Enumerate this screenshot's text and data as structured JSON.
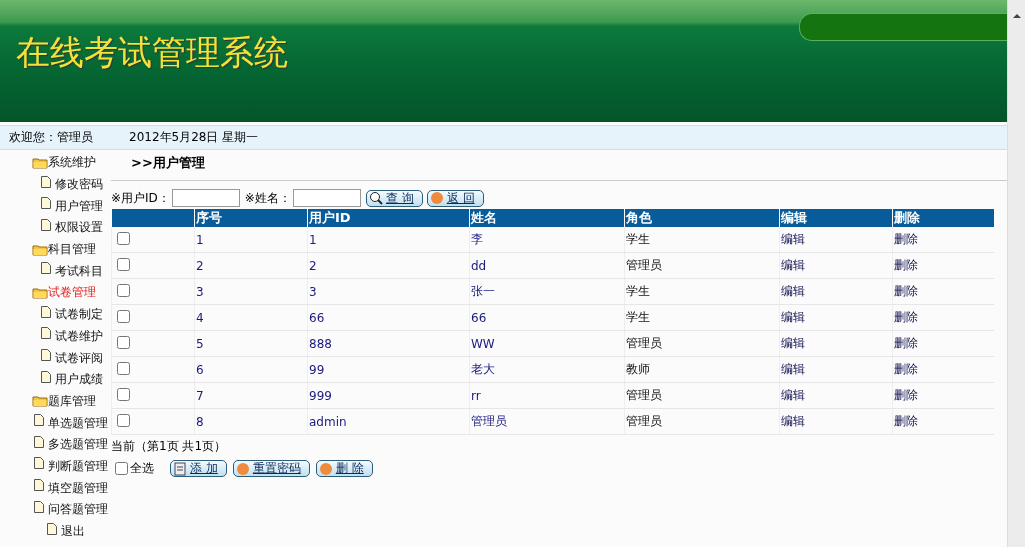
{
  "header": {
    "title": "在线考试管理系统"
  },
  "info_bar": {
    "welcome": "欢迎您：管理员",
    "date": "2012年5月28日  星期一"
  },
  "sidebar": {
    "items": [
      {
        "label": "系统维护",
        "selected": false,
        "children": [
          {
            "label": "修改密码",
            "selected": false
          },
          {
            "label": "用户管理",
            "selected": false
          },
          {
            "label": "权限设置",
            "selected": false
          }
        ]
      },
      {
        "label": "科目管理",
        "selected": false,
        "children": [
          {
            "label": "考试科目",
            "selected": false
          }
        ]
      },
      {
        "label": "试卷管理",
        "selected": true,
        "children": [
          {
            "label": "试卷制定",
            "selected": false
          },
          {
            "label": "试卷维护",
            "selected": false
          },
          {
            "label": "试卷评阅",
            "selected": false
          },
          {
            "label": "用户成绩",
            "selected": false
          }
        ]
      },
      {
        "label": "题库管理",
        "selected": false,
        "children": [
          {
            "label": "单选题管理",
            "selected": false
          },
          {
            "label": "多选题管理",
            "selected": false
          },
          {
            "label": "判断题管理",
            "selected": false
          },
          {
            "label": "填空题管理",
            "selected": false
          },
          {
            "label": "问答题管理",
            "selected": false,
            "children": [
              {
                "label": "退出",
                "selected": false
              }
            ]
          }
        ]
      }
    ]
  },
  "page_title": ">>用户管理",
  "search": {
    "fields": [
      {
        "label": "※用户ID："
      },
      {
        "label": "※姓名："
      }
    ],
    "buttons": [
      {
        "label": "查 询",
        "kind": "search"
      },
      {
        "label": "返 回",
        "kind": "back"
      }
    ]
  },
  "table": {
    "columns": [
      "",
      "序号",
      "用户ID",
      "姓名",
      "角色",
      "编辑",
      "删除"
    ],
    "rows": [
      {
        "checked": false,
        "cells": [
          "",
          "1",
          "1",
          "李",
          "学生",
          "编辑",
          "删除"
        ]
      },
      {
        "checked": false,
        "cells": [
          "",
          "2",
          "2",
          "dd",
          "管理员",
          "编辑",
          "删除"
        ]
      },
      {
        "checked": false,
        "cells": [
          "",
          "3",
          "3",
          "张一",
          "学生",
          "编辑",
          "删除"
        ]
      },
      {
        "checked": false,
        "cells": [
          "",
          "4",
          "66",
          "66",
          "学生",
          "编辑",
          "删除"
        ]
      },
      {
        "checked": false,
        "cells": [
          "",
          "5",
          "888",
          "WW",
          "管理员",
          "编辑",
          "删除"
        ]
      },
      {
        "checked": false,
        "cells": [
          "",
          "6",
          "99",
          "老大",
          "教师",
          "编辑",
          "删除"
        ]
      },
      {
        "checked": false,
        "cells": [
          "",
          "7",
          "999",
          "rr",
          "管理员",
          "编辑",
          "删除"
        ]
      },
      {
        "checked": false,
        "cells": [
          "",
          "8",
          "admin",
          "管理员",
          "管理员",
          "编辑",
          "删除"
        ]
      }
    ]
  },
  "pagination": "当前（第1页  共1页）",
  "select_all": {
    "label": "全选",
    "checked": false
  },
  "actions": [
    {
      "label": "添 加",
      "kind": "add"
    },
    {
      "label": "重置密码",
      "kind": "reset"
    },
    {
      "label": "删 除",
      "kind": "delete"
    }
  ]
}
